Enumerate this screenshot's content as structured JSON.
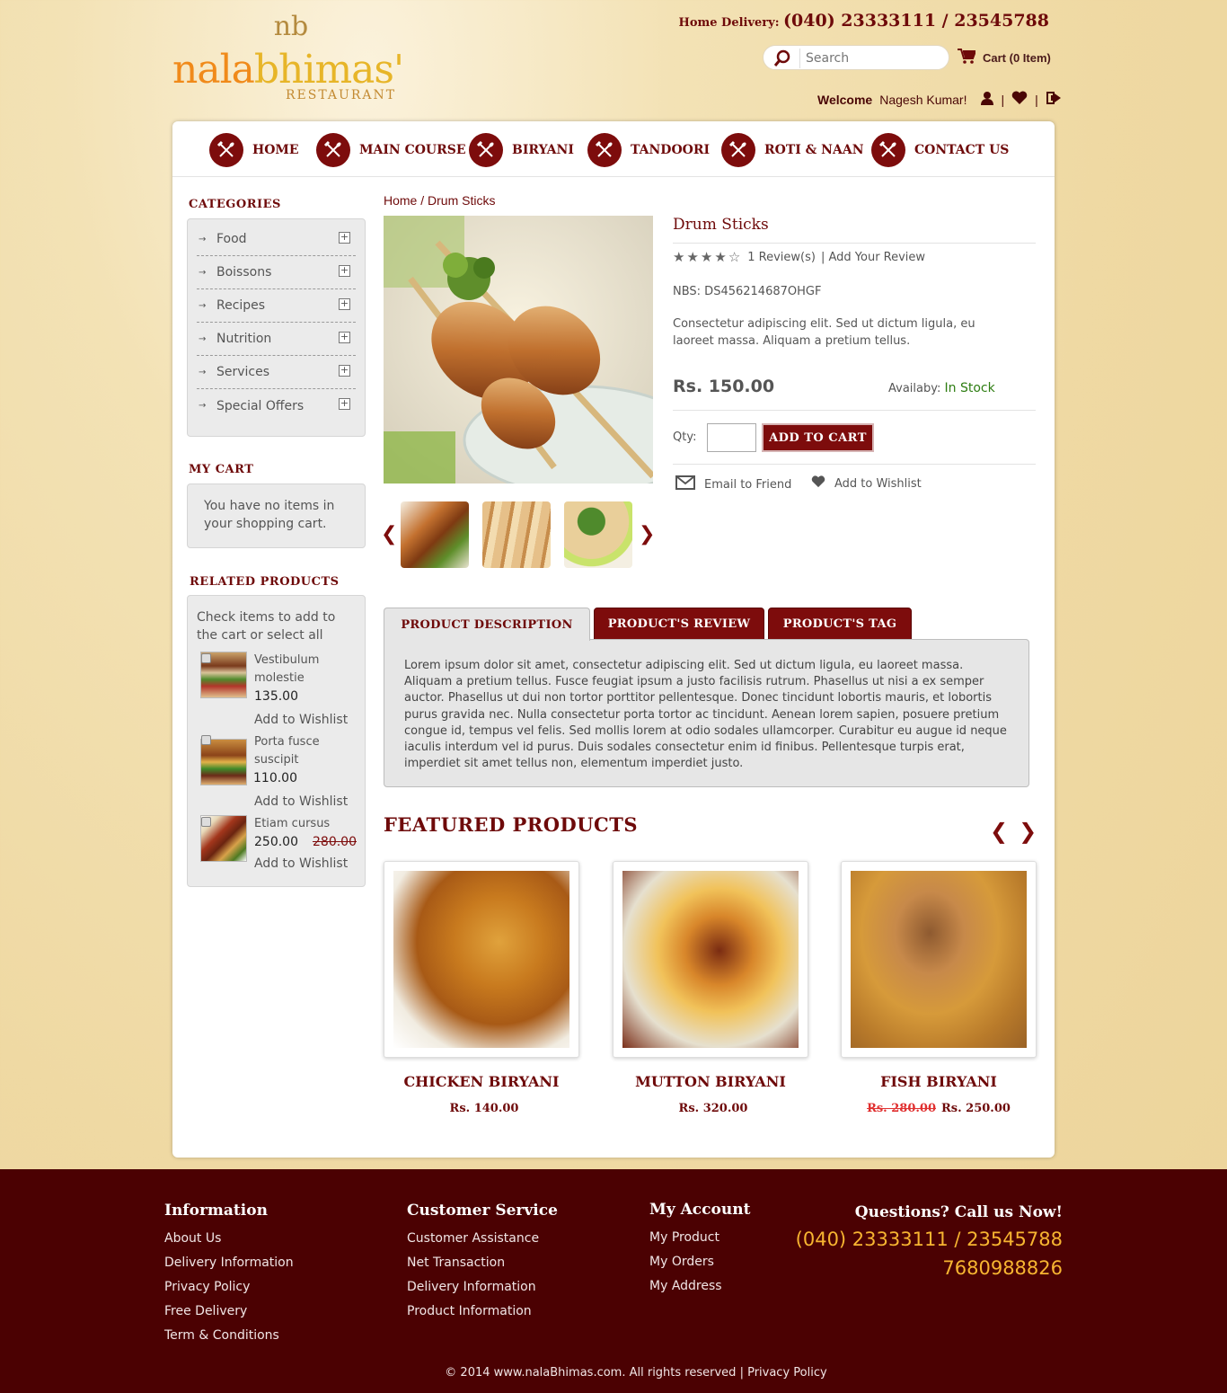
{
  "header": {
    "logo_mark": "nb",
    "logo_word_1": "nala",
    "logo_word_2": "bhimas'",
    "logo_sub": "RESTAURANT",
    "delivery_label": "Home Delivery:",
    "delivery_number": "(040) 23333111 / 23545788",
    "search_placeholder": "Search",
    "cart_label": "Cart (0 Item)",
    "welcome_label": "Welcome",
    "user_name": "Nagesh Kumar!"
  },
  "nav": [
    {
      "label": "HOME"
    },
    {
      "label": "MAIN COURSE"
    },
    {
      "label": "BIRYANI"
    },
    {
      "label": "TANDOORI"
    },
    {
      "label": "ROTI & NAAN"
    },
    {
      "label": "CONTACT US"
    }
  ],
  "sidebar": {
    "categories_title": "CATEGORIES",
    "categories": [
      "Food",
      "Boissons",
      "Recipes",
      "Nutrition",
      "Services",
      "Special Offers"
    ],
    "mycart_title": "MY CART",
    "mycart_text": "You have no items in your shopping cart.",
    "related_title": "RELATED PRODUCTS",
    "related_intro": "Check items to add to the cart or select all",
    "related": [
      {
        "name": "Vestibulum molestie",
        "price": "135.00",
        "old_price": "",
        "wishlist": "Add to Wishlist"
      },
      {
        "name": "Porta fusce suscipit",
        "price": "110.00",
        "old_price": "",
        "wishlist": "Add to Wishlist"
      },
      {
        "name": "Etiam cursus",
        "price": "250.00",
        "old_price": "280.00",
        "wishlist": "Add to Wishlist"
      }
    ]
  },
  "product": {
    "breadcrumb": "Home / Drum Sticks",
    "title": "Drum Sticks",
    "rating": 4,
    "rating_max": 5,
    "reviews": "1 Review(s)",
    "add_review": "| Add Your Review",
    "sku": "NBS: DS456214687OHGF",
    "description": "Consectetur adipiscing elit. Sed ut dictum ligula, eu laoreet massa. Aliquam a pretium tellus.",
    "price": "Rs. 150.00",
    "availability_label": "Availaby:",
    "availability_value": "In Stock",
    "qty_label": "Qty:",
    "qty_value": "",
    "add_to_cart": "ADD TO CART",
    "email_friend": "Email to Friend",
    "add_wishlist": "Add to Wishlist"
  },
  "tabs": {
    "items": [
      "PRODUCT DESCRIPTION",
      "PRODUCT'S REVIEW",
      "PRODUCT'S TAG"
    ],
    "active": 0,
    "body": "Lorem ipsum dolor sit amet, consectetur adipiscing elit. Sed ut dictum ligula, eu laoreet massa. Aliquam a pretium tellus. Fusce feugiat ipsum a justo facilisis rutrum. Phasellus ut nisi a ex semper auctor. Phasellus ut dui non tortor porttitor pellentesque. Donec tincidunt lobortis mauris, et lobortis purus gravida nec. Nulla consectetur porta tortor ac tincidunt. Aenean lorem sapien, posuere pretium congue id, tempus vel felis. Sed mollis lorem at odio sodales ullamcorper. Curabitur eu augue id neque iaculis interdum vel id purus. Duis sodales consectetur enim id finibus. Pellentesque turpis erat, imperdiet sit amet tellus non, elementum imperdiet justo."
  },
  "featured": {
    "title": "FEATURED PRODUCTS",
    "items": [
      {
        "name": "CHICKEN BIRYANI",
        "price": "Rs. 140.00",
        "old_price": ""
      },
      {
        "name": "MUTTON  BIRYANI",
        "price": "Rs. 320.00",
        "old_price": ""
      },
      {
        "name": "FISH BIRYANI",
        "price": "Rs. 250.00",
        "old_price": "Rs. 280.00"
      }
    ]
  },
  "footer": {
    "info_title": "Information",
    "info_links": [
      "About Us",
      "Delivery Information",
      "Privacy Policy",
      "Free Delivery",
      "Term & Conditions"
    ],
    "cs_title": "Customer Service",
    "cs_links": [
      "Customer Assistance",
      "Net Transaction",
      "Delivery Information",
      "Product Information"
    ],
    "account_title": "My Account",
    "account_links": [
      "My Product",
      "My Orders",
      "My Address"
    ],
    "call_title": "Questions? Call us Now!",
    "call_numbers": "(040) 23333111 / 23545788",
    "call_mobile": "7680988826",
    "copyright": "© 2014 www.nalaBhimas.com. All rights reserved",
    "copyright_link": "Privacy Policy"
  },
  "colors": {
    "brand_maroon": "#6e0a0a",
    "footer_bg": "#4b0102",
    "accent_orange": "#f08a1a",
    "in_stock_green": "#2e7d12",
    "page_bg": "#f1dda8"
  }
}
